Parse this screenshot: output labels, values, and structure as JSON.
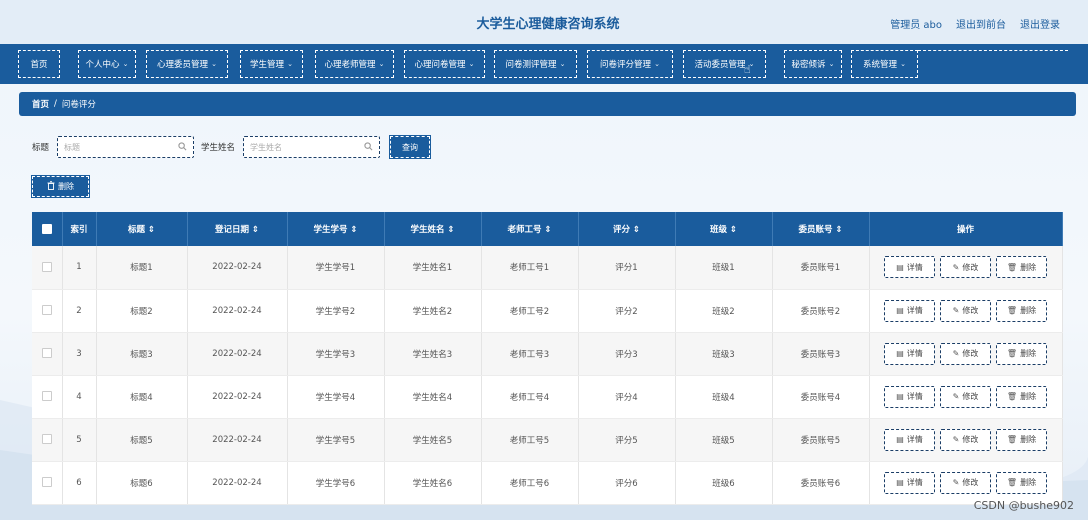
{
  "header": {
    "title": "大学生心理健康咨询系统",
    "admin_label": "管理员 abo",
    "front_label": "退出到前台",
    "logout_label": "退出登录"
  },
  "nav": {
    "items": [
      {
        "label": "首页",
        "chevron": ""
      },
      {
        "label": "个人中心",
        "chevron": "⌄"
      },
      {
        "label": "心理委员管理",
        "chevron": "⌄"
      },
      {
        "label": "学生管理",
        "chevron": "⌄"
      },
      {
        "label": "心理老师管理",
        "chevron": "⌄"
      },
      {
        "label": "心理问卷管理",
        "chevron": "⌄"
      },
      {
        "label": "问卷测评管理",
        "chevron": "⌄"
      },
      {
        "label": "问卷评分管理",
        "chevron": "⌄"
      },
      {
        "label": "活动委员管理",
        "chevron": "⌄"
      },
      {
        "label": "秘密倾诉",
        "chevron": "⌄"
      },
      {
        "label": "系统管理",
        "chevron": "⌄"
      }
    ]
  },
  "breadcrumb": {
    "home": "首页",
    "sep": "/",
    "current": "问卷评分"
  },
  "search": {
    "title_label": "标题",
    "title_placeholder": "标题",
    "student_label": "学生姓名",
    "student_placeholder": "学生姓名",
    "query_label": "查询"
  },
  "toolbar": {
    "delete_label": "删除"
  },
  "table": {
    "columns": [
      "索引",
      "标题 ⇕",
      "登记日期 ⇕",
      "学生学号 ⇕",
      "学生姓名 ⇕",
      "老师工号 ⇕",
      "评分 ⇕",
      "班级 ⇕",
      "委员账号 ⇕",
      "操作"
    ],
    "rows": [
      {
        "index": "1",
        "title": "标题1",
        "date": "2022-02-24",
        "student_no": "学生学号1",
        "student_name": "学生姓名1",
        "teacher_no": "老师工号1",
        "score": "评分1",
        "class": "班级1",
        "member": "委员账号1"
      },
      {
        "index": "2",
        "title": "标题2",
        "date": "2022-02-24",
        "student_no": "学生学号2",
        "student_name": "学生姓名2",
        "teacher_no": "老师工号2",
        "score": "评分2",
        "class": "班级2",
        "member": "委员账号2"
      },
      {
        "index": "3",
        "title": "标题3",
        "date": "2022-02-24",
        "student_no": "学生学号3",
        "student_name": "学生姓名3",
        "teacher_no": "老师工号3",
        "score": "评分3",
        "class": "班级3",
        "member": "委员账号3"
      },
      {
        "index": "4",
        "title": "标题4",
        "date": "2022-02-24",
        "student_no": "学生学号4",
        "student_name": "学生姓名4",
        "teacher_no": "老师工号4",
        "score": "评分4",
        "class": "班级4",
        "member": "委员账号4"
      },
      {
        "index": "5",
        "title": "标题5",
        "date": "2022-02-24",
        "student_no": "学生学号5",
        "student_name": "学生姓名5",
        "teacher_no": "老师工号5",
        "score": "评分5",
        "class": "班级5",
        "member": "委员账号5"
      },
      {
        "index": "6",
        "title": "标题6",
        "date": "2022-02-24",
        "student_no": "学生学号6",
        "student_name": "学生姓名6",
        "teacher_no": "老师工号6",
        "score": "评分6",
        "class": "班级6",
        "member": "委员账号6"
      }
    ],
    "op_labels": {
      "detail": "详情",
      "edit": "修改",
      "delete": "删除"
    }
  },
  "icons": {
    "search": "search-icon",
    "trash": "trash-icon",
    "detail": "document-icon",
    "edit": "pencil-icon",
    "cursor": "hand-cursor-icon"
  },
  "colors": {
    "primary": "#1a5c9d",
    "header_bg": "#e3edf7"
  },
  "watermark": "CSDN @bushe902"
}
